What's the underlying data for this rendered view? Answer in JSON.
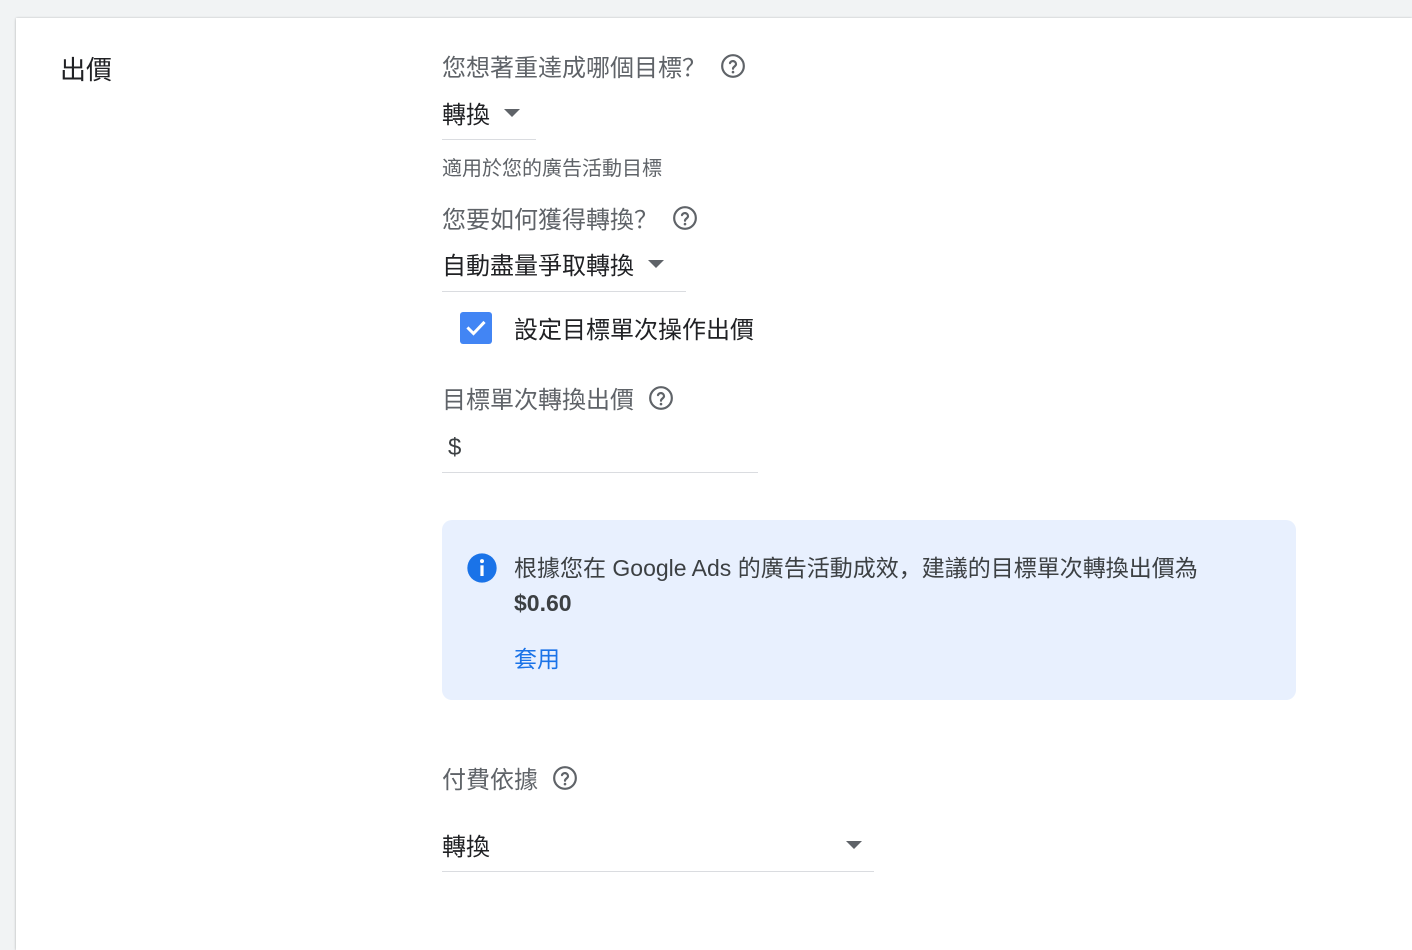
{
  "section": {
    "title": "出價"
  },
  "goal": {
    "question": "您想著重達成哪個目標？",
    "selected": "轉換",
    "helper": "適用於您的廣告活動目標"
  },
  "method": {
    "question": "您要如何獲得轉換？",
    "selected": "自動盡量爭取轉換"
  },
  "target_cpa_toggle": {
    "label": "設定目標單次操作出價",
    "checked": true
  },
  "target_cpa": {
    "label": "目標單次轉換出價",
    "currency_symbol": "$",
    "value": ""
  },
  "recommendation": {
    "text": "根據您在 Google Ads 的廣告活動成效，建議的目標單次轉換出價為",
    "amount": "$0.60",
    "apply_label": "套用"
  },
  "pay_for": {
    "label": "付費依據",
    "selected": "轉換"
  },
  "colors": {
    "accent": "#1a73e8",
    "checkbox": "#4285f4",
    "info_bg": "#e8f0fe"
  }
}
